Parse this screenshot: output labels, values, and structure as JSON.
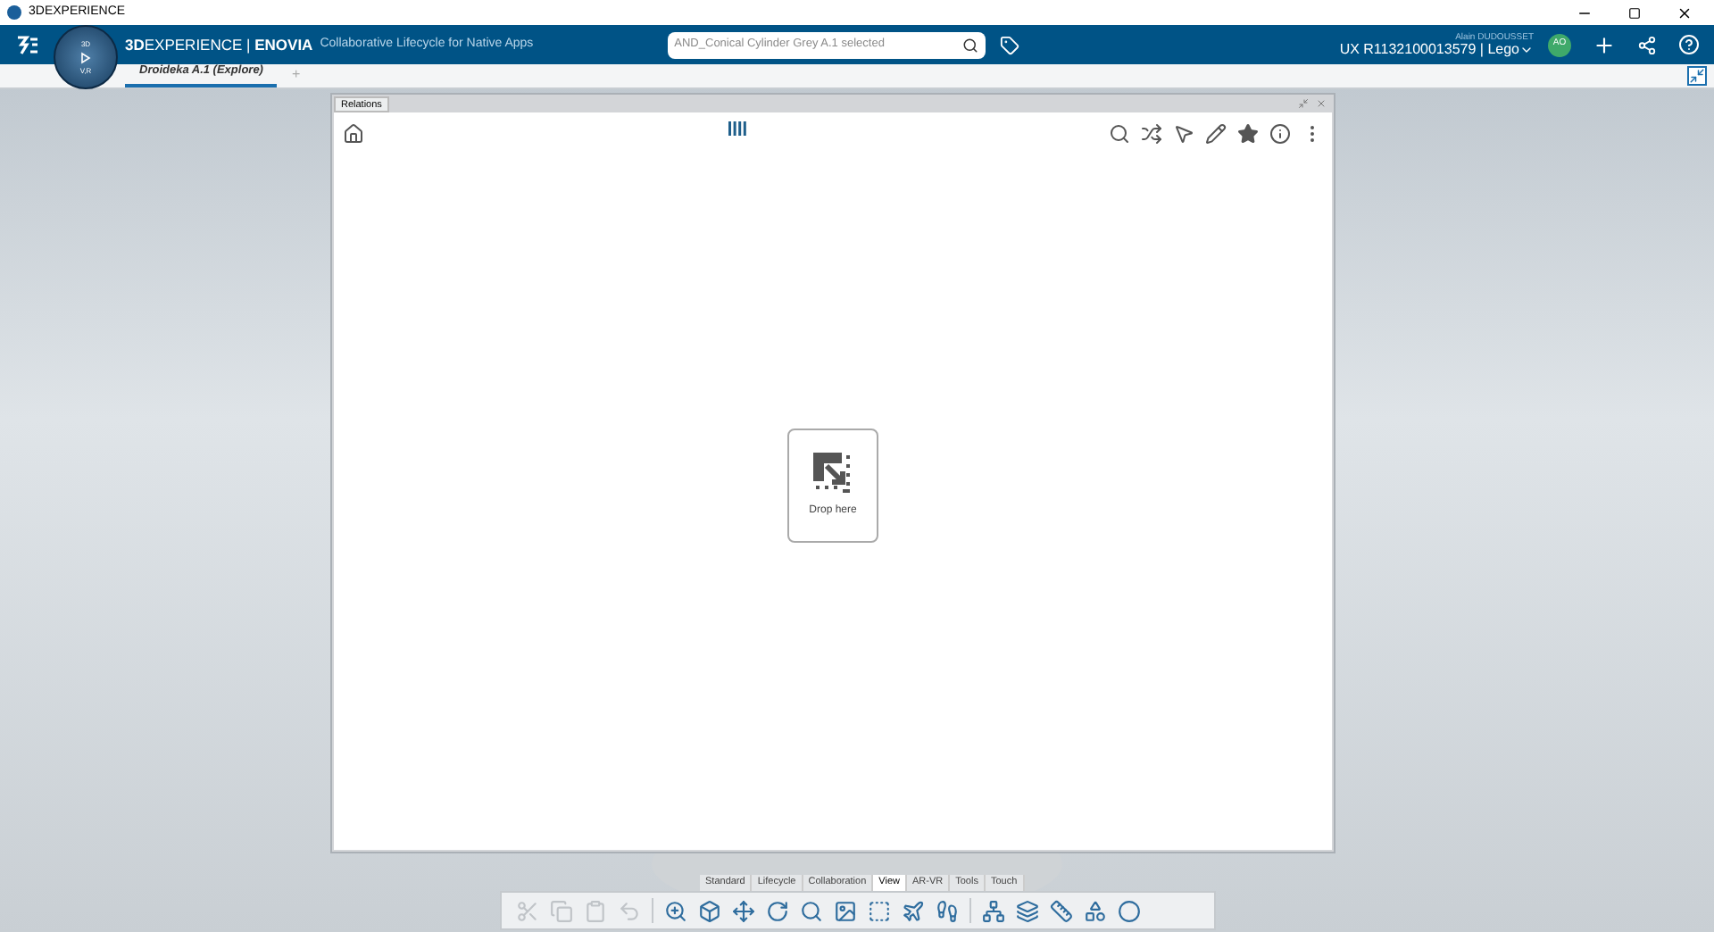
{
  "window": {
    "title": "3DEXPERIENCE"
  },
  "header": {
    "brand": "**3D**EXPERIENCE | **ENOVIA**",
    "app": "Collaborative Lifecycle for Native Apps",
    "compass": {
      "top": "3D",
      "bottom": "V,R"
    },
    "search": {
      "value": "AND_Conical Cylinder Grey A.1 selected"
    },
    "user": "Alain DUDOUSSET",
    "tenant": "UX R1132100013579 | Lego",
    "avatar": "AO"
  },
  "tabs": [
    {
      "label": "Droideka A.1 (Explore)",
      "selected": true
    }
  ],
  "add_tab": "+",
  "panel": {
    "title": "Relations",
    "drop_label": "Drop here"
  },
  "bottom_tabs": [
    {
      "label": "Standard",
      "selected": false
    },
    {
      "label": "Lifecycle",
      "selected": false
    },
    {
      "label": "Collaboration",
      "selected": false
    },
    {
      "label": "View",
      "selected": true
    },
    {
      "label": "AR-VR",
      "selected": false
    },
    {
      "label": "Tools",
      "selected": false
    },
    {
      "label": "Touch",
      "selected": false
    }
  ],
  "toolbar": [
    {
      "kind": "cut",
      "disabled": true
    },
    {
      "kind": "copy",
      "disabled": true
    },
    {
      "kind": "paste",
      "disabled": true
    },
    {
      "kind": "undo",
      "disabled": true
    },
    {
      "kind": "sep"
    },
    {
      "kind": "zoom",
      "disabled": false
    },
    {
      "kind": "cube",
      "disabled": false
    },
    {
      "kind": "pan",
      "disabled": false
    },
    {
      "kind": "rotate",
      "disabled": false
    },
    {
      "kind": "search",
      "disabled": false
    },
    {
      "kind": "render",
      "disabled": false
    },
    {
      "kind": "square",
      "disabled": false
    },
    {
      "kind": "fly",
      "disabled": false
    },
    {
      "kind": "walk",
      "disabled": false
    },
    {
      "kind": "sep"
    },
    {
      "kind": "tree",
      "disabled": false
    },
    {
      "kind": "layers",
      "disabled": false
    },
    {
      "kind": "measure",
      "disabled": false
    },
    {
      "kind": "shape",
      "disabled": false
    },
    {
      "kind": "sphere",
      "disabled": false
    }
  ]
}
